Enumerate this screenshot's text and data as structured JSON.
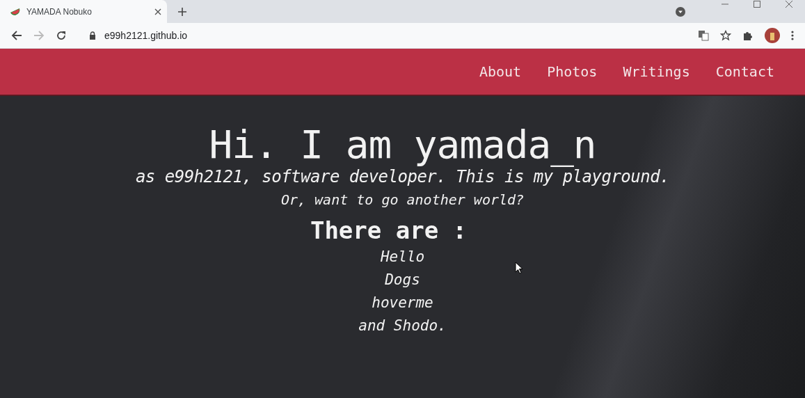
{
  "browser": {
    "tab": {
      "title": "YAMADA Nobuko",
      "selected": true
    },
    "address": "e99h2121.github.io"
  },
  "nav": {
    "items": [
      {
        "label": "About"
      },
      {
        "label": "Photos"
      },
      {
        "label": "Writings"
      },
      {
        "label": "Contact"
      }
    ]
  },
  "hero": {
    "title": "Hi. I am yamada_n",
    "subtitle": "as e99h2121, software developer. This is my playground.",
    "question": "Or, want to go another world?",
    "heading": "There are :",
    "links": [
      {
        "label": "Hello"
      },
      {
        "label": "Dogs"
      },
      {
        "label": "hoverme"
      },
      {
        "label": "and Shodo."
      }
    ]
  }
}
